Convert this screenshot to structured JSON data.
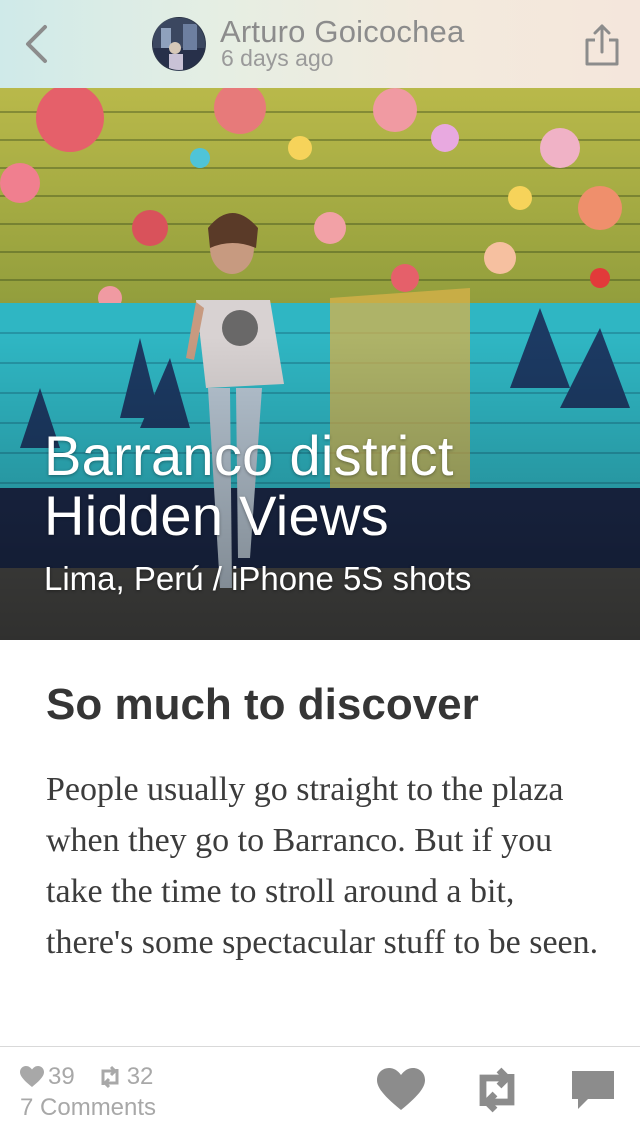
{
  "header": {
    "author_name": "Arturo Goicochea",
    "posted_time": "6 days ago",
    "back_icon": "chevron-left-icon",
    "share_icon": "share-icon"
  },
  "hero": {
    "title": "Barranco district Hidden Views",
    "subtitle": "Lima, Perú / iPhone 5S shots"
  },
  "article": {
    "heading": "So much to discover",
    "paragraph": "People usually go straight to the plaza when they go to Barranco. But if you take the time to stroll around a bit, there's some spectacular stuff to be seen."
  },
  "footer": {
    "likes": "39",
    "reposts": "32",
    "comments": "7 Comments",
    "like_icon": "heart-icon",
    "repost_icon": "repost-icon",
    "comment_icon": "comment-icon"
  },
  "colors": {
    "icon_gray": "#8c8c8c",
    "stat_gray": "#a8a8a8",
    "heading": "#353535",
    "body_text": "#3c3c3c"
  }
}
